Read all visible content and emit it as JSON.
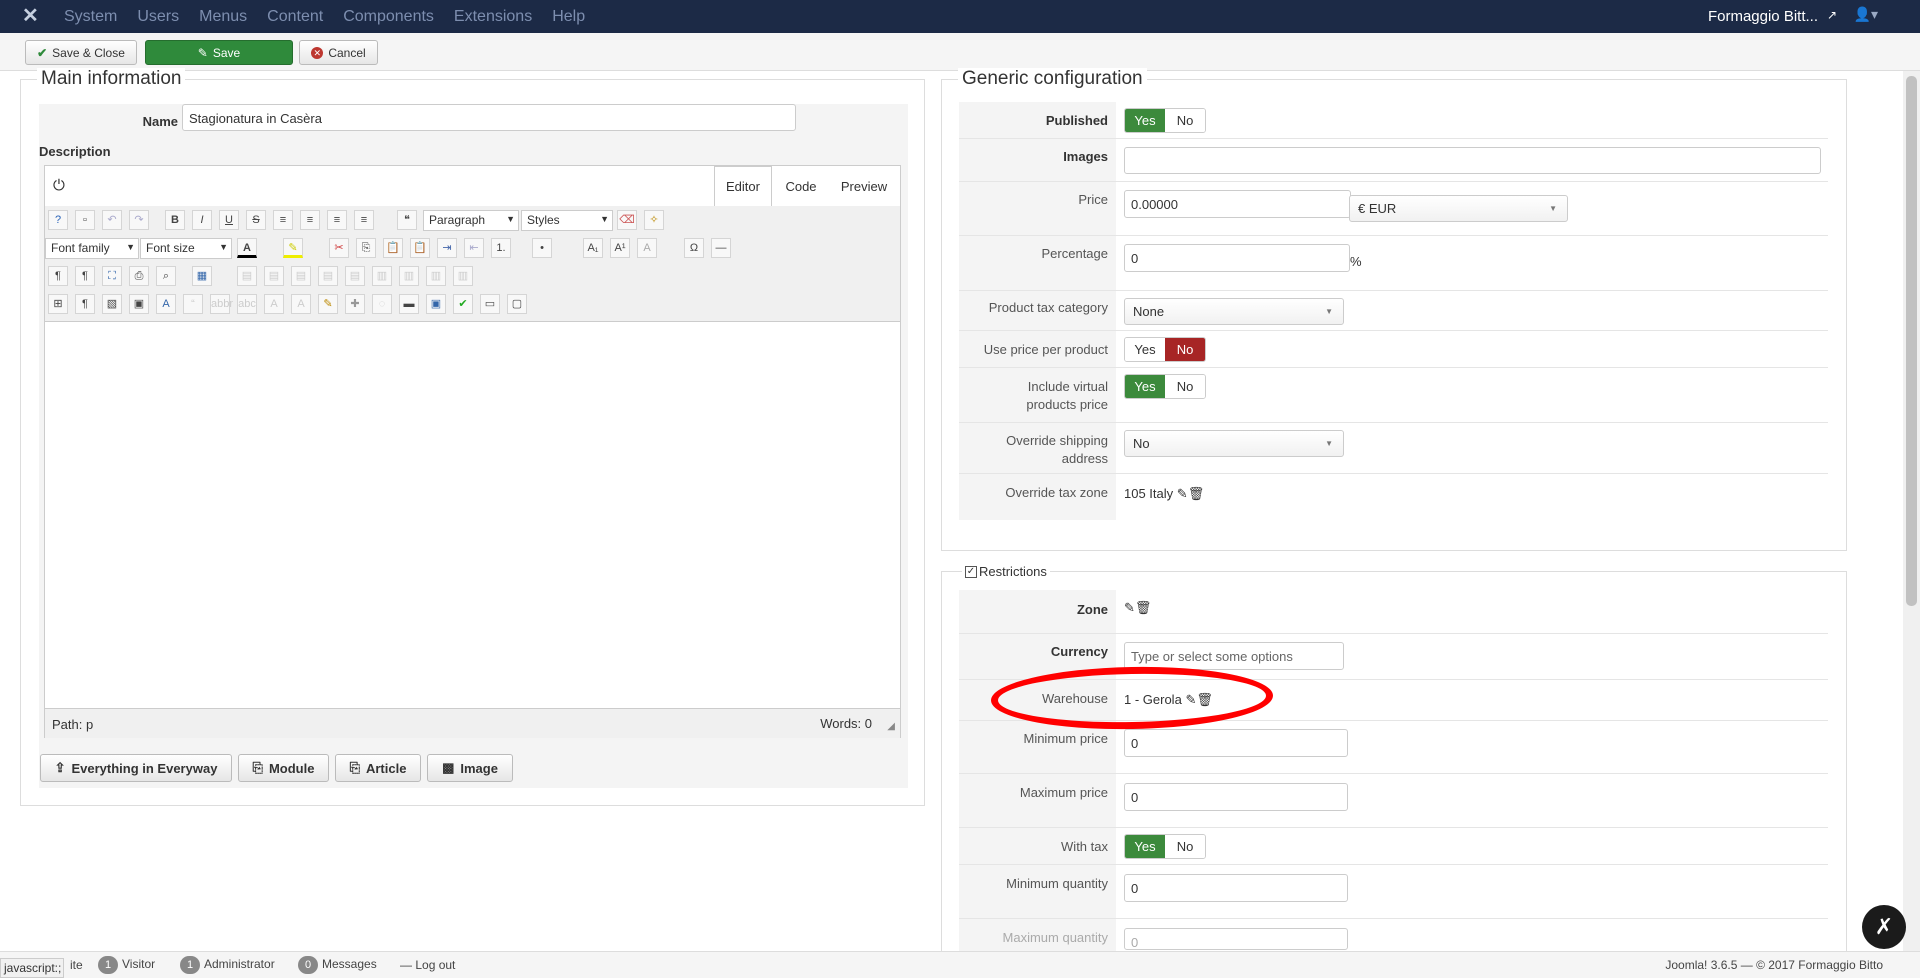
{
  "navbar": {
    "menu": [
      "System",
      "Users",
      "Menus",
      "Content",
      "Components",
      "Extensions",
      "Help"
    ],
    "site_name": "Formaggio Bitt...",
    "icons": {
      "logo": "joomla-logo",
      "external": "external-link-icon",
      "user": "user-icon"
    }
  },
  "toolbar": {
    "save_close": "Save & Close",
    "save": "Save",
    "cancel": "Cancel"
  },
  "main": {
    "legend": "Main information",
    "name_label": "Name",
    "name_value": "Stagionatura in Casèra",
    "description_label": "Description",
    "tabs": [
      "Editor",
      "Code",
      "Preview"
    ],
    "paragraph": "Paragraph",
    "styles": "Styles",
    "font_family": "Font family",
    "font_size": "Font size",
    "path": "Path: p",
    "words": "Words: 0",
    "buttons": [
      "Everything in Everyway",
      "Module",
      "Article",
      "Image"
    ]
  },
  "generic": {
    "legend": "Generic configuration",
    "published_label": "Published",
    "images_label": "Images",
    "price_label": "Price",
    "price_value": "0.00000",
    "currency_value": "€ EUR",
    "percentage_label": "Percentage",
    "percentage_value": "0",
    "percent_sign": "%",
    "tax_cat_label": "Product tax category",
    "tax_cat_value": "None",
    "use_price_label": "Use price per product",
    "virtual_label": "Include virtual products price",
    "shipping_label": "Override shipping address",
    "shipping_value": "No",
    "tax_zone_label": "Override tax zone",
    "tax_zone_value": "105 Italy",
    "yes": "Yes",
    "no": "No"
  },
  "restrictions": {
    "legend": "Restrictions",
    "zone_label": "Zone",
    "currency_label": "Currency",
    "currency_placeholder": "Type or select some options",
    "warehouse_label": "Warehouse",
    "warehouse_value": "1 - Gerola",
    "min_price_label": "Minimum price",
    "min_price_value": "0",
    "max_price_label": "Maximum price",
    "max_price_value": "0",
    "with_tax_label": "With tax",
    "min_qty_label": "Minimum quantity",
    "min_qty_value": "0",
    "max_qty_label": "Maximum quantity",
    "max_qty_value": "0"
  },
  "footer": {
    "js": "javascript:;",
    "site_tail": "ite",
    "visitor_count": "1",
    "visitor": "Visitor",
    "admin_count": "1",
    "admin": "Administrator",
    "messages_count": "0",
    "messages": "Messages",
    "logout": "Log out",
    "version": "Joomla! 3.6.5 — © 2017 Formaggio Bitto"
  },
  "annotation_color": "#ff0000"
}
